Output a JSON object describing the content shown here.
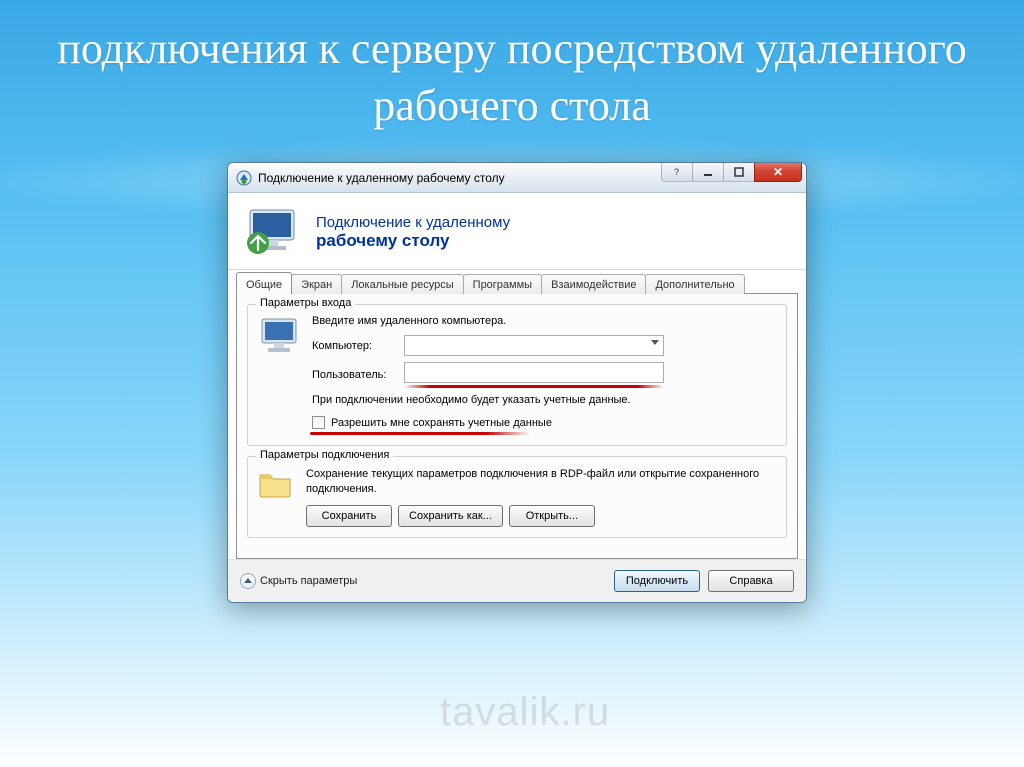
{
  "slide": {
    "title": "подключения к серверу посредством удаленного рабочего стола",
    "watermark": "tavalik.ru"
  },
  "window": {
    "title": "Подключение к удаленному рабочему столу",
    "header_line1": "Подключение к удаленному",
    "header_line2": "рабочему столу",
    "tabs": [
      "Общие",
      "Экран",
      "Локальные ресурсы",
      "Программы",
      "Взаимодействие",
      "Дополнительно"
    ],
    "active_tab_index": 0,
    "login_group": {
      "legend": "Параметры входа",
      "instruction": "Введите имя удаленного компьютера.",
      "computer_label": "Компьютер:",
      "computer_value": "",
      "user_label": "Пользователь:",
      "user_value": "",
      "note": "При подключении необходимо будет указать учетные данные.",
      "checkbox_label": "Разрешить мне сохранять учетные данные"
    },
    "conn_group": {
      "legend": "Параметры подключения",
      "description": "Сохранение текущих параметров подключения в RDP-файл или открытие сохраненного подключения.",
      "save_btn": "Сохранить",
      "saveas_btn": "Сохранить как...",
      "open_btn": "Открыть..."
    },
    "footer": {
      "hide_params": "Скрыть параметры",
      "connect_btn": "Подключить",
      "help_btn": "Справка"
    }
  }
}
